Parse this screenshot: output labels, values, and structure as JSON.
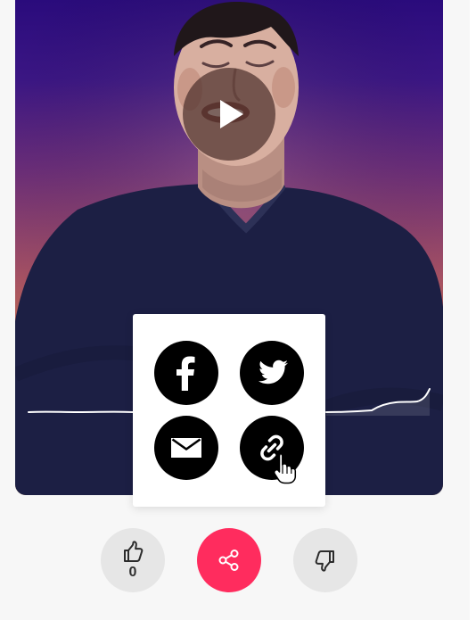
{
  "page": {
    "background": "#f7f7f7"
  },
  "video": {
    "state": "paused",
    "play_icon": "play-icon",
    "gradient_top": "#2a0b7c",
    "gradient_bottom": "#c88935"
  },
  "share_popup": {
    "items": [
      {
        "name": "facebook",
        "icon": "facebook-icon"
      },
      {
        "name": "twitter",
        "icon": "twitter-icon"
      },
      {
        "name": "email",
        "icon": "email-icon"
      },
      {
        "name": "copy-link",
        "icon": "link-icon"
      }
    ]
  },
  "actions": {
    "like_count": "0",
    "like_icon": "thumbs-up-icon",
    "share_icon": "share-icon",
    "dislike_icon": "thumbs-down-icon",
    "share_color": "#ff2c5e",
    "neutral_color": "#e6e6e6"
  }
}
